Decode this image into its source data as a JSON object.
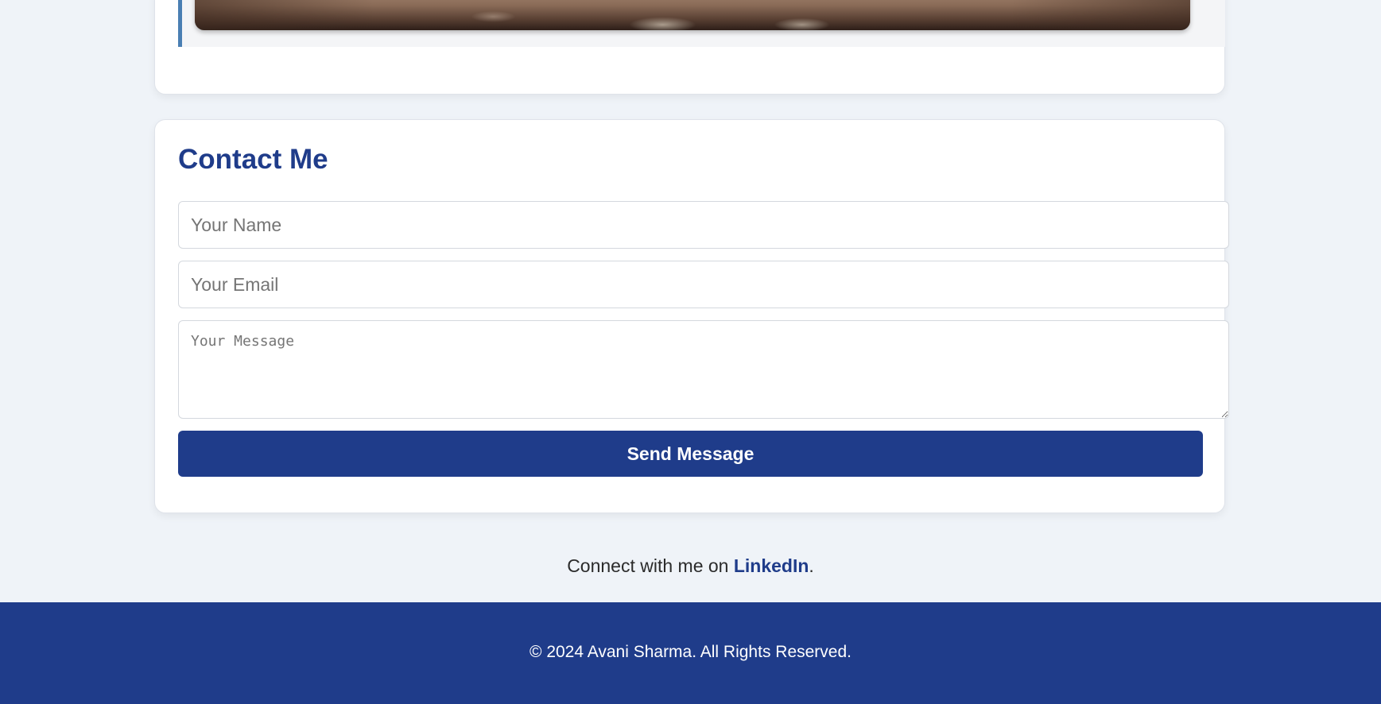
{
  "contact": {
    "title": "Contact Me",
    "name_placeholder": "Your Name",
    "email_placeholder": "Your Email",
    "message_placeholder": "Your Message",
    "submit_label": "Send Message"
  },
  "social": {
    "prefix": "Connect with me on ",
    "link_label": "LinkedIn",
    "suffix": "."
  },
  "footer": {
    "copyright": "© 2024 Avani Sharma. All Rights Reserved."
  },
  "colors": {
    "brand": "#1f3c8a",
    "page_background": "#eff3f8",
    "quote_accent": "#4a7fb3"
  }
}
